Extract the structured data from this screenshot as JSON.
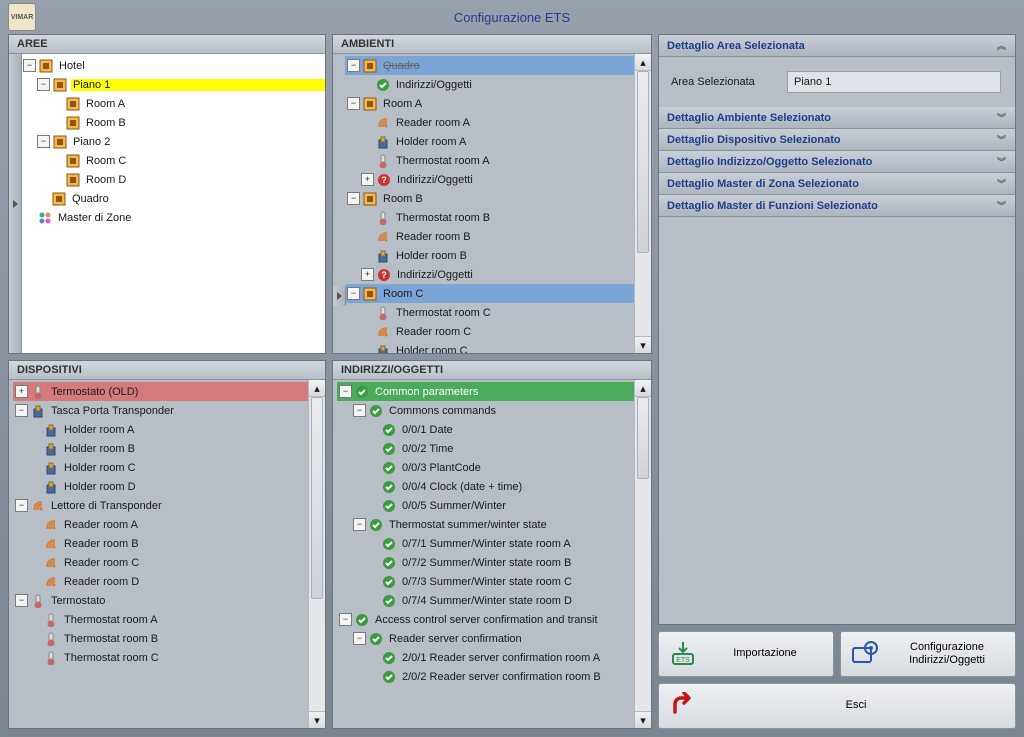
{
  "title": "Configurazione ETS",
  "logo": "VIMAR",
  "panels": {
    "aree": "AREE",
    "ambienti": "AMBIENTI",
    "dispositivi": "DISPOSITIVI",
    "indirizzi": "INDIRIZZI/OGGETTI"
  },
  "aree": {
    "root": "Hotel",
    "p1": "Piano 1",
    "p1a": "Room A",
    "p1b": "Room B",
    "p2": "Piano 2",
    "p2c": "Room C",
    "p2d": "Room D",
    "quadro": "Quadro",
    "master": "Master di Zone"
  },
  "amb": {
    "quadro": "Quadro",
    "io": "Indirizzi/Oggetti",
    "ra": "Room A",
    "ra_r": "Reader room A",
    "ra_h": "Holder room A",
    "ra_t": "Thermostat room A",
    "rb": "Room B",
    "rb_t": "Thermostat room B",
    "rb_r": "Reader room B",
    "rb_h": "Holder room B",
    "rc": "Room C",
    "rc_t": "Thermostat room C",
    "rc_r": "Reader room C",
    "rc_h": "Holder room C"
  },
  "disp": {
    "termo_old": "Termostato (OLD)",
    "tasca": "Tasca Porta Transponder",
    "ha": "Holder room A",
    "hb": "Holder room B",
    "hc": "Holder room C",
    "hd": "Holder room D",
    "lettore": "Lettore di Transponder",
    "ra": "Reader room A",
    "rb": "Reader room B",
    "rc": "Reader room C",
    "rd": "Reader room D",
    "termo": "Termostato",
    "ta": "Thermostat room A",
    "tb": "Thermostat room B",
    "tc": "Thermostat room C"
  },
  "ind": {
    "common": "Common parameters",
    "cmds": "Commons commands",
    "c1": "0/0/1 Date",
    "c2": "0/0/2 Time",
    "c3": "0/0/3 PlantCode",
    "c4": "0/0/4 Clock (date + time)",
    "c5": "0/0/5 Summer/Winter",
    "tsw": "Thermostat summer/winter state",
    "t1": "0/7/1 Summer/Winter state room A",
    "t2": "0/7/2 Summer/Winter state room B",
    "t3": "0/7/3 Summer/Winter state room C",
    "t4": "0/7/4 Summer/Winter state room D",
    "acc": "Access control server confirmation and transit",
    "rsc": "Reader server confirmation",
    "r1": "2/0/1 Reader server confirmation room A",
    "r2": "2/0/2 Reader server confirmation room B"
  },
  "det": {
    "h1": "Dettaglio Area Selezionata",
    "f1l": "Area Selezionata",
    "f1v": "Piano 1",
    "h2": "Dettaglio Ambiente Selezionato",
    "h3": "Dettaglio Dispositivo Selezionato",
    "h4": "Dettaglio Indizizzo/Oggetto Selezionato",
    "h5": "Dettaglio Master di Zona Selezionato",
    "h6": "Dettaglio Master di Funzioni Selezionato"
  },
  "btns": {
    "import": "Importazione",
    "config": "Configurazione Indirizzi/Oggetti",
    "exit": "Esci"
  }
}
